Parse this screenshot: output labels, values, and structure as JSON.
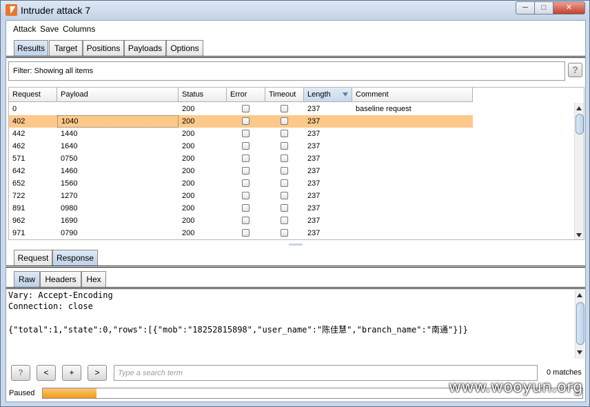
{
  "window": {
    "title": "Intruder attack 7"
  },
  "menu": [
    "Attack",
    "Save",
    "Columns"
  ],
  "main_tabs": [
    {
      "label": "Results",
      "active": true
    },
    {
      "label": "Target",
      "active": false
    },
    {
      "label": "Positions",
      "active": false
    },
    {
      "label": "Payloads",
      "active": false
    },
    {
      "label": "Options",
      "active": false
    }
  ],
  "filter": {
    "text": "Filter:  Showing all items",
    "help": "?"
  },
  "table": {
    "columns": [
      "Request",
      "Payload",
      "Status",
      "Error",
      "Timeout",
      "Length",
      "Comment"
    ],
    "sorted_column": "Length",
    "selected_row": 1,
    "rows": [
      {
        "request": "0",
        "payload": "",
        "status": "200",
        "error": false,
        "timeout": false,
        "length": "237",
        "comment": "baseline request"
      },
      {
        "request": "402",
        "payload": "1040",
        "status": "200",
        "error": false,
        "timeout": false,
        "length": "237",
        "comment": ""
      },
      {
        "request": "442",
        "payload": "1440",
        "status": "200",
        "error": false,
        "timeout": false,
        "length": "237",
        "comment": ""
      },
      {
        "request": "462",
        "payload": "1640",
        "status": "200",
        "error": false,
        "timeout": false,
        "length": "237",
        "comment": ""
      },
      {
        "request": "571",
        "payload": "0750",
        "status": "200",
        "error": false,
        "timeout": false,
        "length": "237",
        "comment": ""
      },
      {
        "request": "642",
        "payload": "1460",
        "status": "200",
        "error": false,
        "timeout": false,
        "length": "237",
        "comment": ""
      },
      {
        "request": "652",
        "payload": "1560",
        "status": "200",
        "error": false,
        "timeout": false,
        "length": "237",
        "comment": ""
      },
      {
        "request": "722",
        "payload": "1270",
        "status": "200",
        "error": false,
        "timeout": false,
        "length": "237",
        "comment": ""
      },
      {
        "request": "891",
        "payload": "0980",
        "status": "200",
        "error": false,
        "timeout": false,
        "length": "237",
        "comment": ""
      },
      {
        "request": "962",
        "payload": "1690",
        "status": "200",
        "error": false,
        "timeout": false,
        "length": "237",
        "comment": ""
      },
      {
        "request": "971",
        "payload": "0790",
        "status": "200",
        "error": false,
        "timeout": false,
        "length": "237",
        "comment": ""
      }
    ]
  },
  "detail_tabs": [
    {
      "label": "Request",
      "active": false
    },
    {
      "label": "Response",
      "active": true
    }
  ],
  "view_tabs": [
    {
      "label": "Raw",
      "active": true
    },
    {
      "label": "Headers",
      "active": false
    },
    {
      "label": "Hex",
      "active": false
    }
  ],
  "response_lines": [
    "Vary: Accept-Encoding",
    "Connection: close",
    "",
    "{\"total\":1,\"state\":0,\"rows\":[{\"mob\":\"18252815898\",\"user_name\":\"陈佳慧\",\"branch_name\":\"南通\"}]}"
  ],
  "search": {
    "help": "?",
    "prev": "<",
    "add": "+",
    "next": ">",
    "placeholder": "Type a search term",
    "matches": "0 matches"
  },
  "status": {
    "label": "Paused",
    "progress": 0.1
  },
  "watermark": "www.wooyun.org"
}
